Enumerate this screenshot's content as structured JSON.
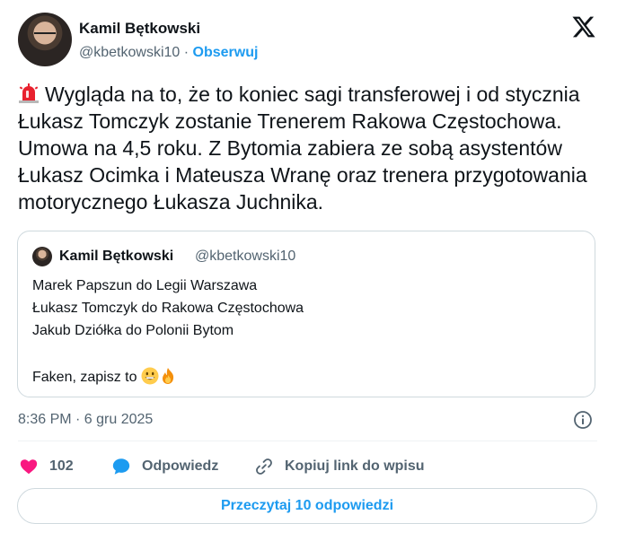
{
  "author": {
    "name": "Kamil Bętkowski",
    "handle": "@kbetkowski10",
    "separator": " · ",
    "follow_label": "Obserwuj"
  },
  "tweet": {
    "icon": "rotating-light-emoji",
    "text": "Wygląda na to, że to koniec sagi transferowej i od stycznia Łukasz Tomczyk zostanie Trenerem Rakowa Częstochowa. Umowa na 4,5 roku. Z Bytomia zabiera ze sobą asystentów Łukasz Ocimka i Mateusza Wranę oraz trenera przygotowania motorycznego Łukasza Juchnika."
  },
  "quote": {
    "name": "Kamil Bętkowski",
    "handle": "@kbetkowski10",
    "lines": [
      "Marek Papszun do Legii Warszawa",
      "Łukasz Tomczyk do Rakowa Częstochowa",
      "Jakub Dziółka do Polonii Bytom",
      "Faken, zapisz to"
    ],
    "emojis": [
      "grinning-face-emoji",
      "fire-emoji"
    ]
  },
  "timestamp": "8:36 PM · 6 gru 2025",
  "actions": {
    "likes": "102",
    "reply_label": "Odpowiedz",
    "copy_label": "Kopiuj link do wpisu"
  },
  "replies_button": "Przeczytaj 10 odpowiedzi",
  "colors": {
    "accent": "#1d9bf0",
    "like": "#f91880",
    "text": "#0f1419",
    "muted": "#536471",
    "border": "#cfd9de"
  }
}
